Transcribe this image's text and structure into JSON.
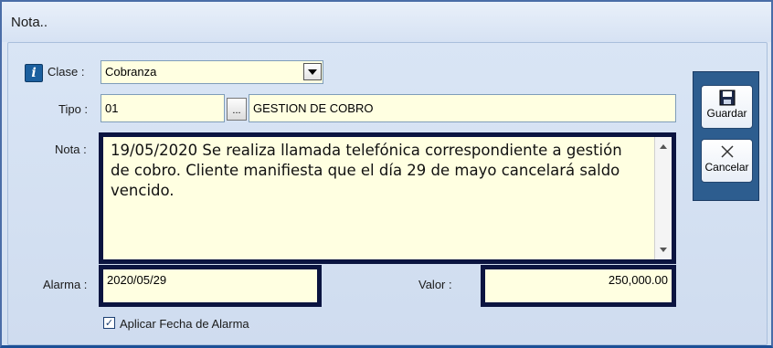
{
  "window": {
    "title": "Nota.."
  },
  "form": {
    "clase_label": "Clase :",
    "clase_value": "Cobranza",
    "tipo_label": "Tipo :",
    "tipo_code": "01",
    "tipo_ellipsis": "...",
    "tipo_desc": "GESTION DE COBRO",
    "nota_label": "Nota :",
    "nota_text": "19/05/2020 Se realiza llamada telefónica correspondiente a gestión de cobro. Cliente manifiesta que el día 29 de mayo cancelará saldo vencido.",
    "alarma_label": "Alarma :",
    "alarma_value": "2020/05/29",
    "valor_label": "Valor :",
    "valor_value": "250,000.00",
    "aplicar_label": "Aplicar Fecha de Alarma",
    "aplicar_checked": true
  },
  "toolbar": {
    "save_label": "Guardar",
    "cancel_label": "Cancelar",
    "save_icon": "floppy-disk-icon",
    "cancel_icon": "close-icon"
  },
  "icons": {
    "info": "i",
    "check": "✓"
  },
  "colors": {
    "field_bg": "#ffffe1",
    "highlight_border": "#0b1440",
    "toolbar_bg": "#2d5d8f"
  }
}
